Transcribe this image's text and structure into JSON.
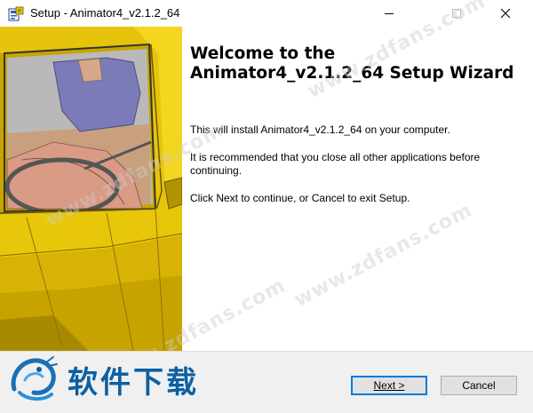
{
  "window": {
    "title": "Setup - Animator4_v2.1.2_64",
    "icon": "setup-app-icon",
    "controls": {
      "minimize": "minimize-icon",
      "maximize": "maximize-icon",
      "close": "close-icon"
    }
  },
  "welcome": {
    "heading": "Welcome to the Animator4_v2.1.2_64 Setup Wizard",
    "install_text": "This will install Animator4_v2.1.2_64 on your computer.",
    "recommend_text": "It is recommended that you close all other applications before continuing.",
    "instruction_text": "Click Next to continue, or Cancel to exit Setup."
  },
  "buttons": {
    "next_label": "Next >",
    "cancel_label": "Cancel"
  },
  "watermark": {
    "text": "www.zdfans.com"
  },
  "brand": {
    "text": "软件下载",
    "color": "#0d5fa0"
  },
  "colors": {
    "car_body": "#e8c60a",
    "car_dark": "#9a8200",
    "seat": "#7a7bb8",
    "accent_focus": "#0078d7"
  }
}
